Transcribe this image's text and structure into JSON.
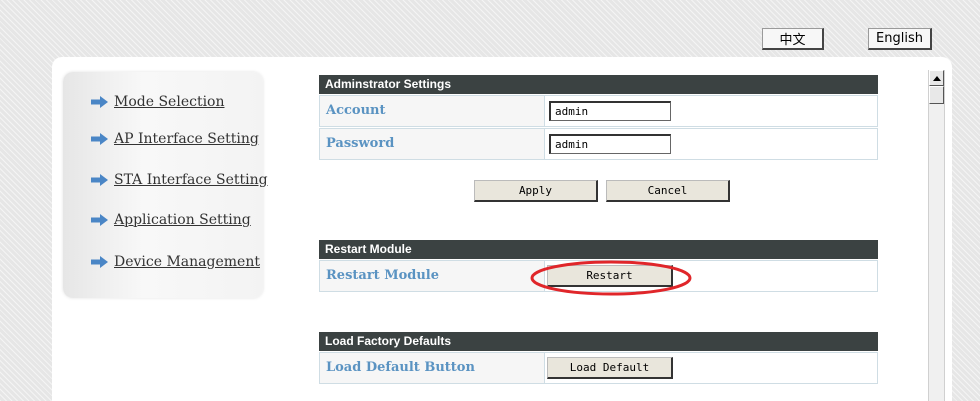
{
  "language": {
    "chinese_label": "中文",
    "english_label": "English"
  },
  "sidebar": {
    "items": [
      {
        "label": "Mode Selection"
      },
      {
        "label": "AP Interface Setting"
      },
      {
        "label": "STA Interface Setting"
      },
      {
        "label": "Application Setting"
      },
      {
        "label": "Device Management"
      }
    ]
  },
  "admin": {
    "header": "Adminstrator Settings",
    "account_label": "Account",
    "account_value": "admin",
    "password_label": "Password",
    "password_value": "admin",
    "apply_label": "Apply",
    "cancel_label": "Cancel"
  },
  "restart": {
    "header": "Restart Module",
    "row_label": "Restart Module",
    "button_label": "Restart",
    "highlight_color": "#e0262a"
  },
  "factory": {
    "header": "Load Factory Defaults",
    "row_label": "Load Default Button",
    "button_label": "Load Default"
  },
  "colors": {
    "section_header_bg": "#3b4242",
    "label_text": "#5a93c2",
    "nav_arrow": "#4a86c6"
  }
}
